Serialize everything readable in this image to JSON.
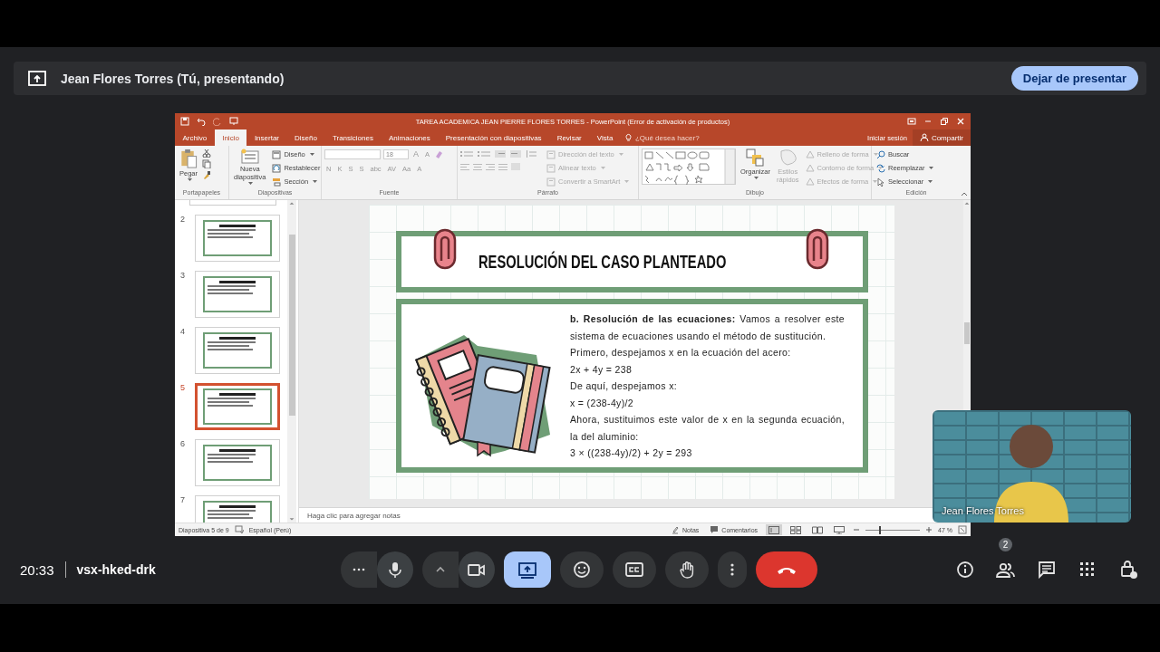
{
  "presenting_bar": {
    "title": "Jean Flores Torres (Tú, presentando)",
    "stop_button": "Dejar de presentar"
  },
  "powerpoint": {
    "title": "TAREA ACADEMICA JEAN PIERRE FLORES TORRES - PowerPoint (Error de activación de productos)",
    "tabs": [
      {
        "label": "Archivo",
        "selected": false
      },
      {
        "label": "Inicio",
        "selected": true
      },
      {
        "label": "Insertar",
        "selected": false
      },
      {
        "label": "Diseño",
        "selected": false
      },
      {
        "label": "Transiciones",
        "selected": false
      },
      {
        "label": "Animaciones",
        "selected": false
      },
      {
        "label": "Presentación con diapositivas",
        "selected": false
      },
      {
        "label": "Revisar",
        "selected": false
      },
      {
        "label": "Vista",
        "selected": false
      }
    ],
    "tell_me": "¿Qué desea hacer?",
    "sign_in": "Iniciar sesión",
    "share": "Compartir",
    "ribbon": {
      "clipboard": {
        "label": "Portapapeles",
        "paste": "Pegar"
      },
      "slides": {
        "label": "Diapositivas",
        "new_slide": "Nueva diapositiva",
        "layout": "Diseño",
        "reset": "Restablecer",
        "section": "Sección"
      },
      "font": {
        "label": "Fuente",
        "size": "18",
        "size_buttons": [
          "A",
          "A"
        ],
        "styles": [
          "N",
          "K",
          "S",
          "S",
          "abc",
          "AV",
          "Aa",
          "A"
        ]
      },
      "paragraph": {
        "label": "Párrafo",
        "commands": [
          {
            "label": "Dirección del texto",
            "disabled": true
          },
          {
            "label": "Alinear texto",
            "disabled": true
          },
          {
            "label": "Convertir a SmartArt",
            "disabled": true
          }
        ]
      },
      "drawing": {
        "label": "Dibujo",
        "arrange": "Organizar",
        "quick_styles": {
          "label": "Estilos rápidos",
          "disabled": true
        },
        "format_commands": [
          {
            "label": "Relleno de forma",
            "disabled": true
          },
          {
            "label": "Contorno de forma",
            "disabled": true
          },
          {
            "label": "Efectos de forma",
            "disabled": true
          }
        ]
      },
      "editing": {
        "label": "Edición",
        "find": "Buscar",
        "replace": "Reemplazar",
        "select": "Seleccionar"
      }
    },
    "thumbnails": [
      {
        "number": "2",
        "selected": false
      },
      {
        "number": "3",
        "selected": false
      },
      {
        "number": "4",
        "selected": false
      },
      {
        "number": "5",
        "selected": true
      },
      {
        "number": "6",
        "selected": false
      },
      {
        "number": "7",
        "selected": false
      }
    ],
    "slide": {
      "title": "RESOLUCIÓN DEL CASO PLANTEADO",
      "paragraphs": [
        "**b. Resolución de las ecuaciones:** Vamos a resolver este sistema de ecuaciones usando el método de sustitución.",
        "Primero, despejamos x en la ecuación del acero:",
        "2x + 4y = 238",
        "De aquí, despejamos x:",
        "x = (238-4y)/2",
        "Ahora, sustituimos este valor de x en la segunda ecuación, la del aluminio:",
        "3 × ((238-4y)/2) + 2y = 293"
      ]
    },
    "notes_placeholder": "Haga clic para agregar notas",
    "status_bar": {
      "slide_count": "Diapositiva 5 de 9",
      "language": "Español (Perú)",
      "notes": "Notas",
      "comments": "Comentarios",
      "views": [
        {
          "kind": "normal",
          "selected": true
        },
        {
          "kind": "sorter",
          "selected": false
        },
        {
          "kind": "reading",
          "selected": false
        },
        {
          "kind": "slideshow",
          "selected": false
        }
      ],
      "zoom": {
        "level": 0.25,
        "reading": "47 %"
      }
    }
  },
  "video_tile": {
    "name": "Jean Flores Torres"
  },
  "call_bar": {
    "time": "20:33",
    "meeting_code": "vsx-hked-drk",
    "controls": [
      {
        "kind": "more",
        "highlighted": false
      },
      {
        "kind": "microphone",
        "highlighted": false
      },
      {
        "kind": "caret",
        "highlighted": false
      },
      {
        "kind": "camera",
        "highlighted": false
      },
      {
        "kind": "present",
        "highlighted": true
      },
      {
        "kind": "reactions",
        "highlighted": false
      },
      {
        "kind": "captions",
        "highlighted": false
      },
      {
        "kind": "raise-hand",
        "highlighted": false
      },
      {
        "kind": "more-vert",
        "highlighted": false
      },
      {
        "kind": "end-call",
        "highlighted": false
      }
    ],
    "side_controls": [
      {
        "kind": "info"
      },
      {
        "kind": "people",
        "badge": "2"
      },
      {
        "kind": "chat"
      },
      {
        "kind": "activities"
      },
      {
        "kind": "host-controls"
      }
    ]
  }
}
